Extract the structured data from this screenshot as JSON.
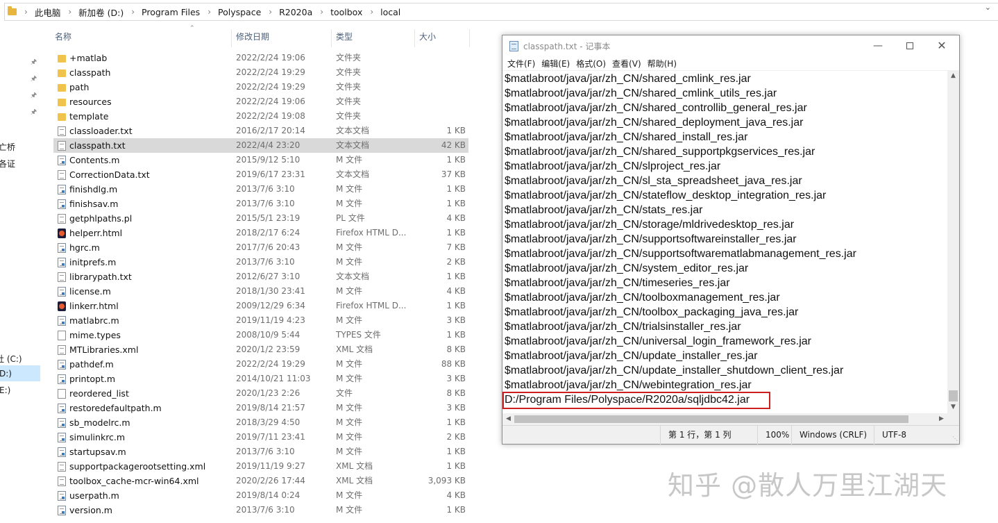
{
  "explorer": {
    "breadcrumb": [
      "此电脑",
      "新加卷 (D:)",
      "Program Files",
      "Polyspace",
      "R2020a",
      "toolbox",
      "local"
    ],
    "columns": {
      "name": "名称",
      "date": "修改日期",
      "type": "类型",
      "size": "大小"
    },
    "nav_fragments": [
      "亡桥",
      "各证",
      "牡 (C:)",
      "D:)",
      "E:)"
    ],
    "files": [
      {
        "name": "+matlab",
        "date": "2022/2/24 19:06",
        "type": "文件夹",
        "size": "",
        "icon": "folder"
      },
      {
        "name": "classpath",
        "date": "2022/2/24 19:29",
        "type": "文件夹",
        "size": "",
        "icon": "folder"
      },
      {
        "name": "path",
        "date": "2022/2/24 19:29",
        "type": "文件夹",
        "size": "",
        "icon": "folder"
      },
      {
        "name": "resources",
        "date": "2022/2/24 19:06",
        "type": "文件夹",
        "size": "",
        "icon": "folder"
      },
      {
        "name": "template",
        "date": "2022/2/24 19:08",
        "type": "文件夹",
        "size": "",
        "icon": "folder"
      },
      {
        "name": "classloader.txt",
        "date": "2016/2/17 20:14",
        "type": "文本文档",
        "size": "1 KB",
        "icon": "txt"
      },
      {
        "name": "classpath.txt",
        "date": "2022/4/4 23:20",
        "type": "文本文档",
        "size": "42 KB",
        "icon": "txt",
        "selected": true
      },
      {
        "name": "Contents.m",
        "date": "2015/9/12 5:10",
        "type": "M 文件",
        "size": "1 KB",
        "icon": "m"
      },
      {
        "name": "CorrectionData.txt",
        "date": "2019/6/17 23:31",
        "type": "文本文档",
        "size": "37 KB",
        "icon": "txt"
      },
      {
        "name": "finishdlg.m",
        "date": "2013/7/6 3:10",
        "type": "M 文件",
        "size": "1 KB",
        "icon": "m"
      },
      {
        "name": "finishsav.m",
        "date": "2013/7/6 3:10",
        "type": "M 文件",
        "size": "1 KB",
        "icon": "m"
      },
      {
        "name": "getphlpaths.pl",
        "date": "2015/5/1 23:19",
        "type": "PL 文件",
        "size": "4 KB",
        "icon": "pl"
      },
      {
        "name": "helperr.html",
        "date": "2018/2/17 6:24",
        "type": "Firefox HTML D...",
        "size": "1 KB",
        "icon": "html"
      },
      {
        "name": "hgrc.m",
        "date": "2017/7/6 20:43",
        "type": "M 文件",
        "size": "7 KB",
        "icon": "m"
      },
      {
        "name": "initprefs.m",
        "date": "2013/7/6 3:10",
        "type": "M 文件",
        "size": "2 KB",
        "icon": "m"
      },
      {
        "name": "librarypath.txt",
        "date": "2012/6/27 3:10",
        "type": "文本文档",
        "size": "1 KB",
        "icon": "txt"
      },
      {
        "name": "license.m",
        "date": "2018/1/30 23:41",
        "type": "M 文件",
        "size": "4 KB",
        "icon": "m"
      },
      {
        "name": "linkerr.html",
        "date": "2009/12/29 6:34",
        "type": "Firefox HTML D...",
        "size": "1 KB",
        "icon": "html"
      },
      {
        "name": "matlabrc.m",
        "date": "2019/11/19 4:23",
        "type": "M 文件",
        "size": "3 KB",
        "icon": "m"
      },
      {
        "name": "mime.types",
        "date": "2008/10/9 5:44",
        "type": "TYPES 文件",
        "size": "1 KB",
        "icon": "generic"
      },
      {
        "name": "MTLibraries.xml",
        "date": "2020/1/2 23:59",
        "type": "XML 文档",
        "size": "8 KB",
        "icon": "xml"
      },
      {
        "name": "pathdef.m",
        "date": "2022/2/24 19:29",
        "type": "M 文件",
        "size": "88 KB",
        "icon": "m"
      },
      {
        "name": "printopt.m",
        "date": "2014/10/21 11:03",
        "type": "M 文件",
        "size": "3 KB",
        "icon": "m"
      },
      {
        "name": "reordered_list",
        "date": "2020/1/23 2:26",
        "type": "文件",
        "size": "8 KB",
        "icon": "generic"
      },
      {
        "name": "restoredefaultpath.m",
        "date": "2019/8/14 21:57",
        "type": "M 文件",
        "size": "3 KB",
        "icon": "m"
      },
      {
        "name": "sb_modelrc.m",
        "date": "2018/3/29 4:50",
        "type": "M 文件",
        "size": "1 KB",
        "icon": "m"
      },
      {
        "name": "simulinkrc.m",
        "date": "2019/7/11 23:41",
        "type": "M 文件",
        "size": "2 KB",
        "icon": "m"
      },
      {
        "name": "startupsav.m",
        "date": "2013/7/6 3:10",
        "type": "M 文件",
        "size": "1 KB",
        "icon": "m"
      },
      {
        "name": "supportpackagerootsetting.xml",
        "date": "2019/11/19 9:27",
        "type": "XML 文档",
        "size": "1 KB",
        "icon": "xml"
      },
      {
        "name": "toolbox_cache-mcr-win64.xml",
        "date": "2020/2/26 17:44",
        "type": "XML 文档",
        "size": "3,093 KB",
        "icon": "xml"
      },
      {
        "name": "userpath.m",
        "date": "2019/8/14 0:24",
        "type": "M 文件",
        "size": "4 KB",
        "icon": "m"
      },
      {
        "name": "version.m",
        "date": "2013/7/6 3:10",
        "type": "M 文件",
        "size": "1 KB",
        "icon": "m"
      }
    ]
  },
  "notepad": {
    "title": "classpath.txt - 记事本",
    "menu": [
      "文件(F)",
      "编辑(E)",
      "格式(O)",
      "查看(V)",
      "帮助(H)"
    ],
    "lines": [
      "$matlabroot/java/jar/zh_CN/shared_cmlink_res.jar",
      "$matlabroot/java/jar/zh_CN/shared_cmlink_utils_res.jar",
      "$matlabroot/java/jar/zh_CN/shared_controllib_general_res.jar",
      "$matlabroot/java/jar/zh_CN/shared_deployment_java_res.jar",
      "$matlabroot/java/jar/zh_CN/shared_install_res.jar",
      "$matlabroot/java/jar/zh_CN/shared_supportpkgservices_res.jar",
      "$matlabroot/java/jar/zh_CN/slproject_res.jar",
      "$matlabroot/java/jar/zh_CN/sl_sta_spreadsheet_java_res.jar",
      "$matlabroot/java/jar/zh_CN/stateflow_desktop_integration_res.jar",
      "$matlabroot/java/jar/zh_CN/stats_res.jar",
      "$matlabroot/java/jar/zh_CN/storage/mldrivedesktop_res.jar",
      "$matlabroot/java/jar/zh_CN/supportsoftwareinstaller_res.jar",
      "$matlabroot/java/jar/zh_CN/supportsoftwarematlabmanagement_res.jar",
      "$matlabroot/java/jar/zh_CN/system_editor_res.jar",
      "$matlabroot/java/jar/zh_CN/timeseries_res.jar",
      "$matlabroot/java/jar/zh_CN/toolboxmanagement_res.jar",
      "$matlabroot/java/jar/zh_CN/toolbox_packaging_java_res.jar",
      "$matlabroot/java/jar/zh_CN/trialsinstaller_res.jar",
      "$matlabroot/java/jar/zh_CN/universal_login_framework_res.jar",
      "$matlabroot/java/jar/zh_CN/update_installer_res.jar",
      "$matlabroot/java/jar/zh_CN/update_installer_shutdown_client_res.jar",
      "$matlabroot/java/jar/zh_CN/webintegration_res.jar",
      "D:/Program Files/Polyspace/R2020a/sqljdbc42.jar"
    ],
    "status": {
      "position": "第 1 行，第 1 列",
      "zoom": "100%",
      "line_ending": "Windows (CRLF)",
      "encoding": "UTF-8"
    }
  },
  "watermark": "知乎 @散人万里江湖天"
}
